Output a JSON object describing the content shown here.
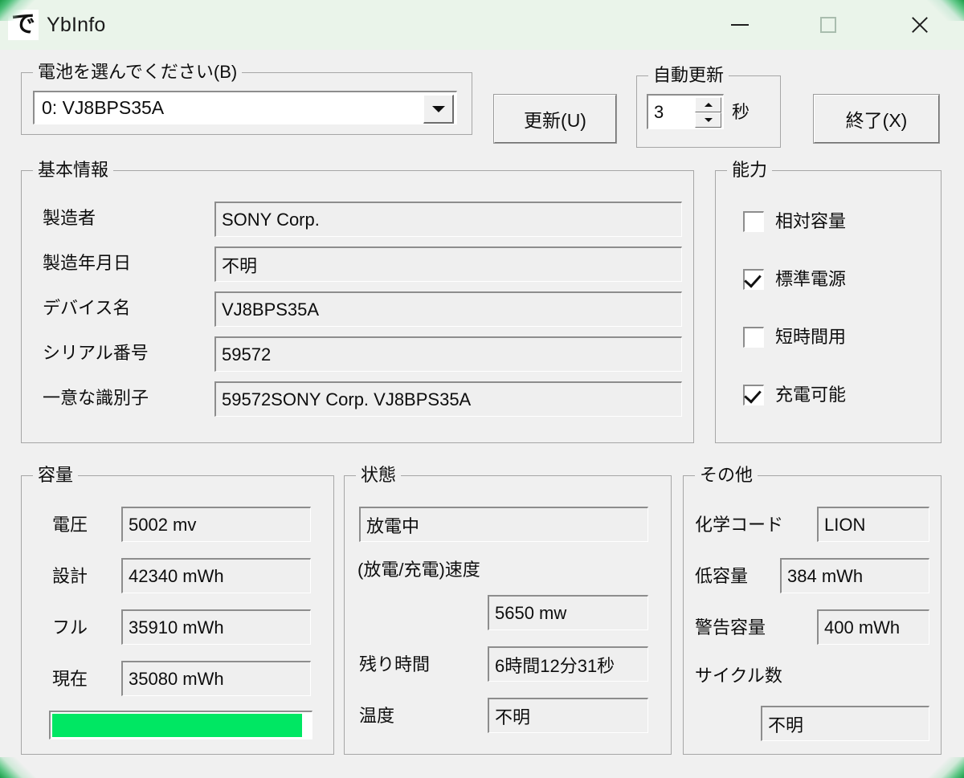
{
  "window": {
    "title": "YbInfo",
    "icon_glyph": "で",
    "controls": {
      "minimize": "—",
      "maximize": "□",
      "close": "✕"
    }
  },
  "battery_select": {
    "group_title": "電池を選んでください(B)",
    "selected": "0: VJ8BPS35A",
    "options": [
      "0: VJ8BPS35A"
    ]
  },
  "toolbar": {
    "refresh_label": "更新(U)",
    "exit_label": "終了(X)"
  },
  "auto_refresh": {
    "group_title": "自動更新",
    "value": "3",
    "unit": "秒"
  },
  "basic_info": {
    "group_title": "基本情報",
    "rows": [
      {
        "label": "製造者",
        "value": "SONY Corp."
      },
      {
        "label": "製造年月日",
        "value": "不明"
      },
      {
        "label": "デバイス名",
        "value": "VJ8BPS35A"
      },
      {
        "label": "シリアル番号",
        "value": "59572"
      },
      {
        "label": "一意な識別子",
        "value": "59572SONY Corp. VJ8BPS35A"
      }
    ]
  },
  "capability": {
    "group_title": "能力",
    "items": [
      {
        "label": "相対容量",
        "checked": false
      },
      {
        "label": "標準電源",
        "checked": true
      },
      {
        "label": "短時間用",
        "checked": false
      },
      {
        "label": "充電可能",
        "checked": true
      }
    ]
  },
  "capacity": {
    "group_title": "容量",
    "rows": [
      {
        "label": "電圧",
        "value": "5002 mv"
      },
      {
        "label": "設計",
        "value": "42340 mWh"
      },
      {
        "label": "フル",
        "value": "35910 mWh"
      },
      {
        "label": "現在",
        "value": "35080 mWh"
      }
    ],
    "progress_percent": 97,
    "progress_color": "#00e763"
  },
  "status": {
    "group_title": "状態",
    "state_value": "放電中",
    "rate_label": "(放電/充電)速度",
    "rate_value": "5650 mw",
    "remaining_label": "残り時間",
    "remaining_value": "6時間12分31秒",
    "temperature_label": "温度",
    "temperature_value": "不明"
  },
  "other": {
    "group_title": "その他",
    "chem_label": "化学コード",
    "chem_value": "LION",
    "low_label": "低容量",
    "low_value": "384 mWh",
    "warn_label": "警告容量",
    "warn_value": "400 mWh",
    "cycles_label": "サイクル数",
    "cycles_value": "不明"
  }
}
